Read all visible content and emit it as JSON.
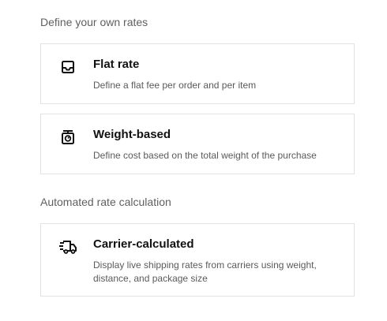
{
  "sections": [
    {
      "heading": "Define your own rates",
      "options": [
        {
          "icon": "inbox-tray-icon",
          "title": "Flat rate",
          "description": "Define a flat fee per order and per item"
        },
        {
          "icon": "scale-icon",
          "title": "Weight-based",
          "description": "Define cost based on the total weight of the purchase"
        }
      ]
    },
    {
      "heading": "Automated rate calculation",
      "options": [
        {
          "icon": "delivery-truck-icon",
          "title": "Carrier-calculated",
          "description": "Display live shipping rates from carriers using weight, distance, and package size"
        }
      ]
    }
  ]
}
